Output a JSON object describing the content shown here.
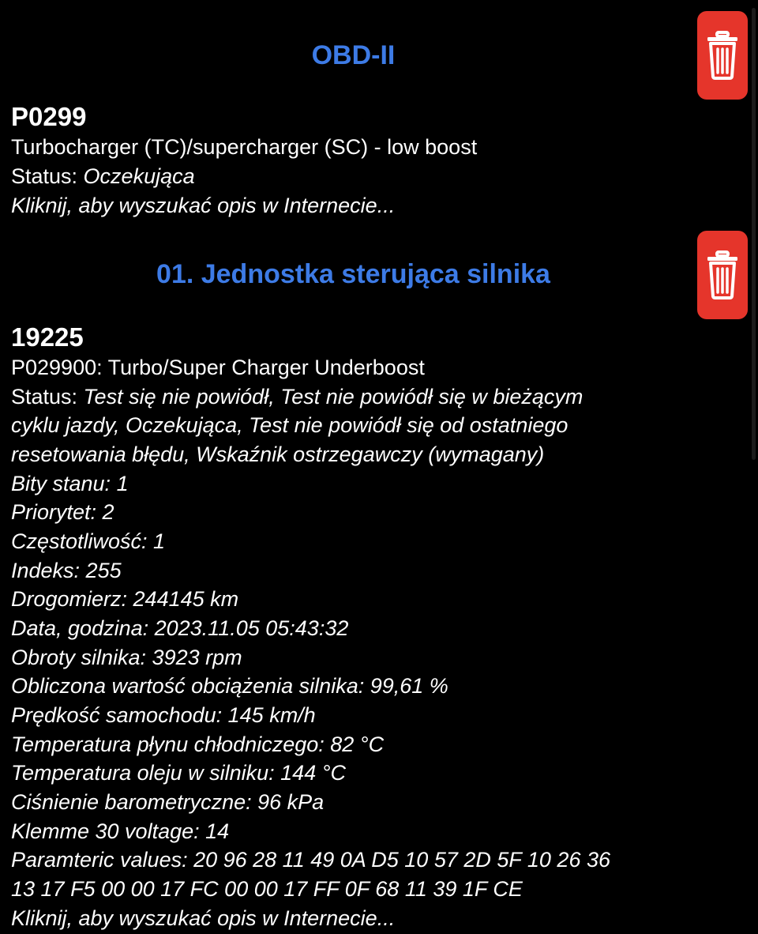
{
  "colors": {
    "background": "#000000",
    "section_title": "#3d7be6",
    "delete_button": "#e5352b",
    "text": "#ffffff"
  },
  "sections": [
    {
      "title": "OBD-II",
      "delete_icon": "trash-icon",
      "code": "P0299",
      "description": "Turbocharger (TC)/supercharger (SC) - low boost",
      "status_label": "Status: ",
      "status_value": "Oczekująca",
      "search_link": "Kliknij, aby wyszukać opis w Internecie..."
    },
    {
      "title": "01. Jednostka sterująca silnika",
      "delete_icon": "trash-icon",
      "code": "19225",
      "description": "P029900: Turbo/Super Charger Underboost",
      "status_label": "Status: ",
      "status_lines": [
        "Test się nie powiódł, Test nie powiódł się w bieżącym",
        "cyklu jazdy, Oczekująca, Test nie powiódł się od ostatniego",
        "resetowania błędu, Wskaźnik ostrzegawczy (wymagany)"
      ],
      "details": [
        "Bity stanu: 1",
        "Priorytet: 2",
        "Częstotliwość: 1",
        "Indeks: 255",
        "Drogomierz: 244145 km",
        "Data, godzina: 2023.11.05 05:43:32",
        "Obroty silnika: 3923 rpm",
        "Obliczona wartość obciążenia silnika: 99,61 %",
        "Prędkość samochodu: 145 km/h",
        "Temperatura płynu chłodniczego: 82 °C",
        "Temperatura oleju w silniku: 144 °C",
        "Ciśnienie barometryczne: 96 kPa",
        "Klemme 30 voltage: 14",
        "Paramteric values:  20 96 28 11 49 0A D5 10 57 2D 5F 10 26 36",
        "13 17 F5 00 00 17 FC 00 00 17 FF 0F 68 11 39 1F CE"
      ],
      "search_link": "Kliknij, aby wyszukać opis w Internecie..."
    }
  ]
}
